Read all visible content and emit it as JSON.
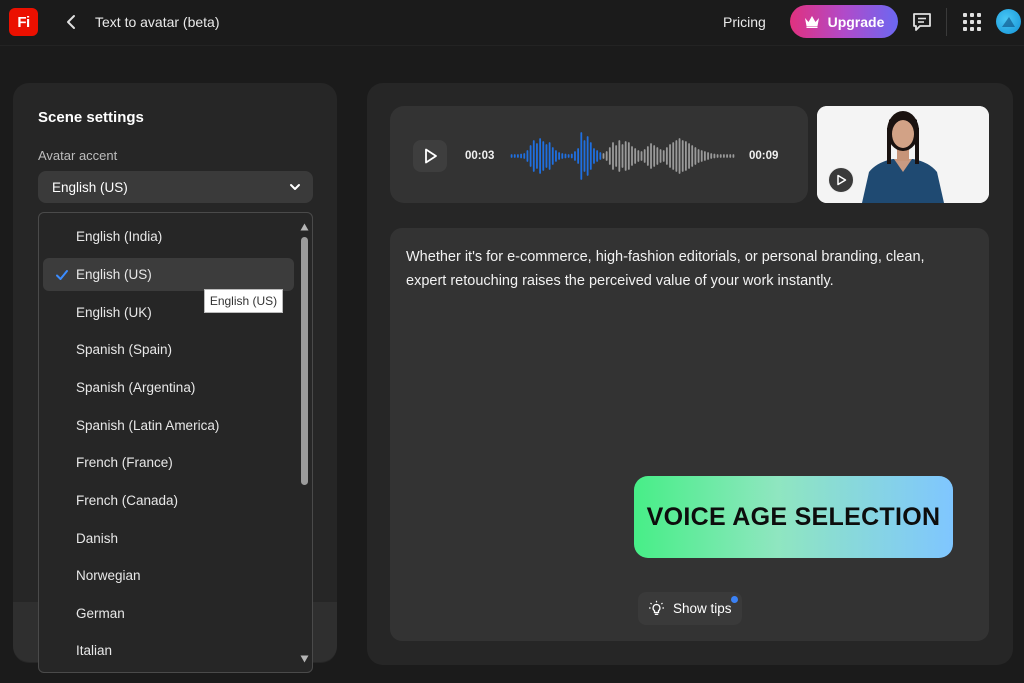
{
  "app": {
    "logo_text": "Fi",
    "title": "Text to avatar (beta)",
    "pricing_label": "Pricing",
    "upgrade_label": "Upgrade"
  },
  "colors": {
    "logo_red": "#eb1000",
    "upgrade_gradient": [
      "#e0317f",
      "#b14ac9",
      "#6b68f2"
    ],
    "waveform_active": "#1f6fe0",
    "waveform_inactive": "#9a9a9a",
    "banner_gradient": [
      "#47ee87",
      "#8fe6c0",
      "#7fc6ff"
    ],
    "notification_dot": "#3b82f6"
  },
  "icons": [
    "back-chevron-icon",
    "crown-icon",
    "chat-icon",
    "apps-grid-icon",
    "profile-avatar-icon",
    "chevron-down-icon",
    "checkmark-icon",
    "play-icon",
    "lightbulb-icon"
  ],
  "scene_settings": {
    "title": "Scene settings",
    "accent_label": "Avatar accent",
    "accent_selected": "English (US)",
    "options": [
      {
        "label": "English (India)",
        "selected": false
      },
      {
        "label": "English (US)",
        "selected": true
      },
      {
        "label": "English (UK)",
        "selected": false
      },
      {
        "label": "Spanish (Spain)",
        "selected": false
      },
      {
        "label": "Spanish (Argentina)",
        "selected": false
      },
      {
        "label": "Spanish (Latin America)",
        "selected": false
      },
      {
        "label": "French (France)",
        "selected": false
      },
      {
        "label": "French (Canada)",
        "selected": false
      },
      {
        "label": "Danish",
        "selected": false
      },
      {
        "label": "Norwegian",
        "selected": false
      },
      {
        "label": "German",
        "selected": false
      },
      {
        "label": "Italian",
        "selected": false
      }
    ],
    "tooltip": "English (US)"
  },
  "audio": {
    "time_start": "00:03",
    "time_end": "00:09"
  },
  "script": {
    "text": "Whether it's for e-commerce, high-fashion editorials, or personal branding, clean, expert retouching raises the perceived value of your work instantly."
  },
  "banner": {
    "text": "VOICE AGE SELECTION"
  },
  "tips": {
    "label": "Show tips"
  }
}
